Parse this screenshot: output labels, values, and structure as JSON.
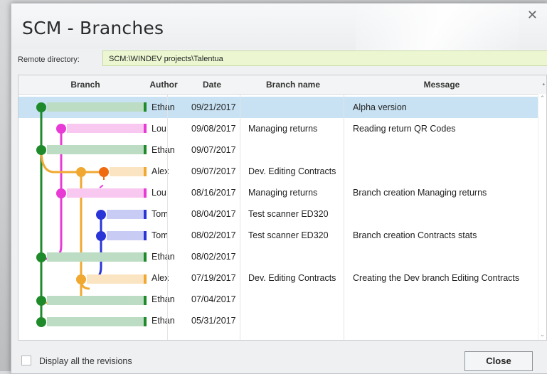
{
  "window": {
    "title": "SCM - Branches",
    "close_glyph": "✕"
  },
  "remote": {
    "label": "Remote directory:",
    "value": "SCM:\\WINDEV projects\\Talentua"
  },
  "table": {
    "headers": [
      "Branch",
      "Author",
      "Date",
      "Branch name",
      "Message"
    ],
    "rows": [
      {
        "author": "Ethan",
        "date": "09/21/2017",
        "branch": "",
        "message": "Alpha version",
        "selected": true,
        "color": "#1f8a2a"
      },
      {
        "author": "Lou",
        "date": "09/08/2017",
        "branch": "Managing returns",
        "message": "Reading return QR Codes",
        "selected": false,
        "color": "#e83bd6"
      },
      {
        "author": "Ethan",
        "date": "09/07/2017",
        "branch": "",
        "message": "",
        "selected": false,
        "color": "#1f8a2a"
      },
      {
        "author": "Alex",
        "date": "09/07/2017",
        "branch": "Dev. Editing Contracts",
        "message": "",
        "selected": false,
        "color": "#f0a830"
      },
      {
        "author": "Lou",
        "date": "08/16/2017",
        "branch": "Managing returns",
        "message": "Branch creation Managing returns",
        "selected": false,
        "color": "#e83bd6"
      },
      {
        "author": "Tom",
        "date": "08/04/2017",
        "branch": "Test scanner ED320",
        "message": "",
        "selected": false,
        "color": "#2a35d8"
      },
      {
        "author": "Tom",
        "date": "08/02/2017",
        "branch": "Test scanner ED320",
        "message": "Branch creation Contracts stats",
        "selected": false,
        "color": "#2a35d8"
      },
      {
        "author": "Ethan",
        "date": "08/02/2017",
        "branch": "",
        "message": "",
        "selected": false,
        "color": "#1f8a2a"
      },
      {
        "author": "Alex",
        "date": "07/19/2017",
        "branch": "Dev. Editing Contracts",
        "message": "Creating the Dev branch Editing Contracts",
        "selected": false,
        "color": "#f0a830"
      },
      {
        "author": "Ethan",
        "date": "07/04/2017",
        "branch": "",
        "message": "",
        "selected": false,
        "color": "#1f8a2a"
      },
      {
        "author": "Ethan",
        "date": "05/31/2017",
        "branch": "",
        "message": "",
        "selected": false,
        "color": "#1f8a2a"
      }
    ]
  },
  "footer": {
    "checkbox_label": "Display all the revisions",
    "checkbox_checked": false,
    "close_label": "Close"
  }
}
